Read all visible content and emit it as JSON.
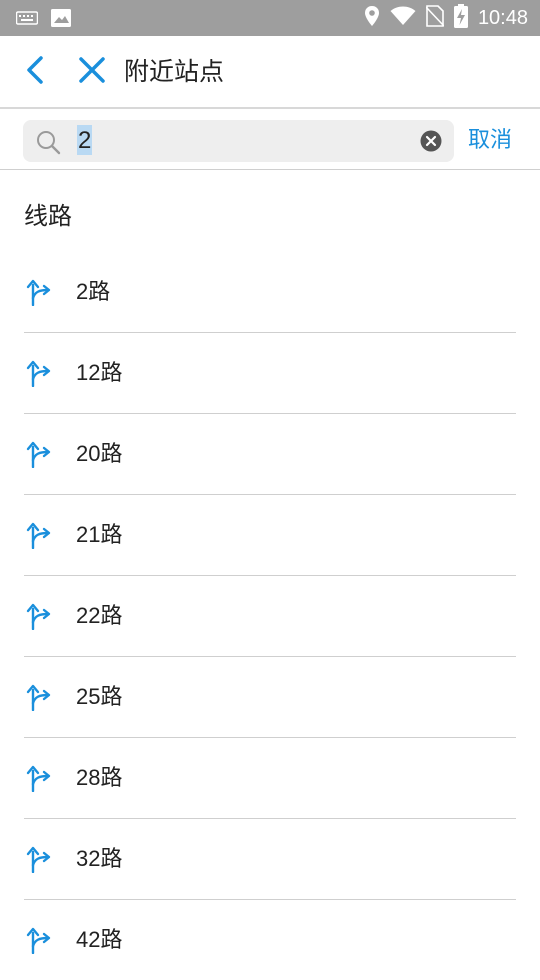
{
  "status_bar": {
    "time": "10:48",
    "icons": [
      "keyboard-icon",
      "image-icon",
      "location-icon",
      "wifi-icon",
      "no-sim-icon",
      "battery-charging-icon"
    ]
  },
  "header": {
    "title": "附近站点",
    "back_icon": "chevron-left-icon",
    "close_icon": "close-icon"
  },
  "search": {
    "value": "2",
    "cancel_label": "取消"
  },
  "section": {
    "title": "线路"
  },
  "routes": [
    {
      "label": "2路"
    },
    {
      "label": "12路"
    },
    {
      "label": "20路"
    },
    {
      "label": "21路"
    },
    {
      "label": "22路"
    },
    {
      "label": "25路"
    },
    {
      "label": "28路"
    },
    {
      "label": "32路"
    },
    {
      "label": "42路"
    }
  ],
  "colors": {
    "accent": "#1a8fdc",
    "status_bar": "#9e9e9e",
    "search_bg": "#eeeeee",
    "divider": "#d8d8d8"
  }
}
